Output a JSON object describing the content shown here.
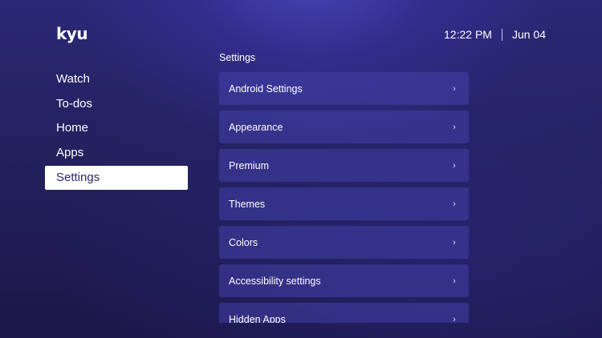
{
  "app": {
    "logo_text": "kyu"
  },
  "status": {
    "time": "12:22 PM",
    "date": "Jun 04"
  },
  "nav": {
    "items": [
      {
        "label": "Watch",
        "active": false
      },
      {
        "label": "To-dos",
        "active": false
      },
      {
        "label": "Home",
        "active": false
      },
      {
        "label": "Apps",
        "active": false
      },
      {
        "label": "Settings",
        "active": true
      }
    ]
  },
  "settings": {
    "title": "Settings",
    "items": [
      {
        "label": "Android Settings",
        "icon": "chevron-right-icon"
      },
      {
        "label": "Appearance",
        "icon": "chevron-right-icon"
      },
      {
        "label": "Premium",
        "icon": "chevron-right-icon"
      },
      {
        "label": "Themes",
        "icon": "chevron-right-icon"
      },
      {
        "label": "Colors",
        "icon": "chevron-right-icon"
      },
      {
        "label": "Accessibility settings",
        "icon": "chevron-right-icon"
      },
      {
        "label": "Hidden Apps",
        "icon": "chevron-right-icon"
      }
    ],
    "chevron_glyph": "›"
  },
  "colors": {
    "background": "#23215e",
    "accent": "#3a36a0",
    "selected_bg": "#ffffff",
    "selected_text": "#2a2770"
  }
}
